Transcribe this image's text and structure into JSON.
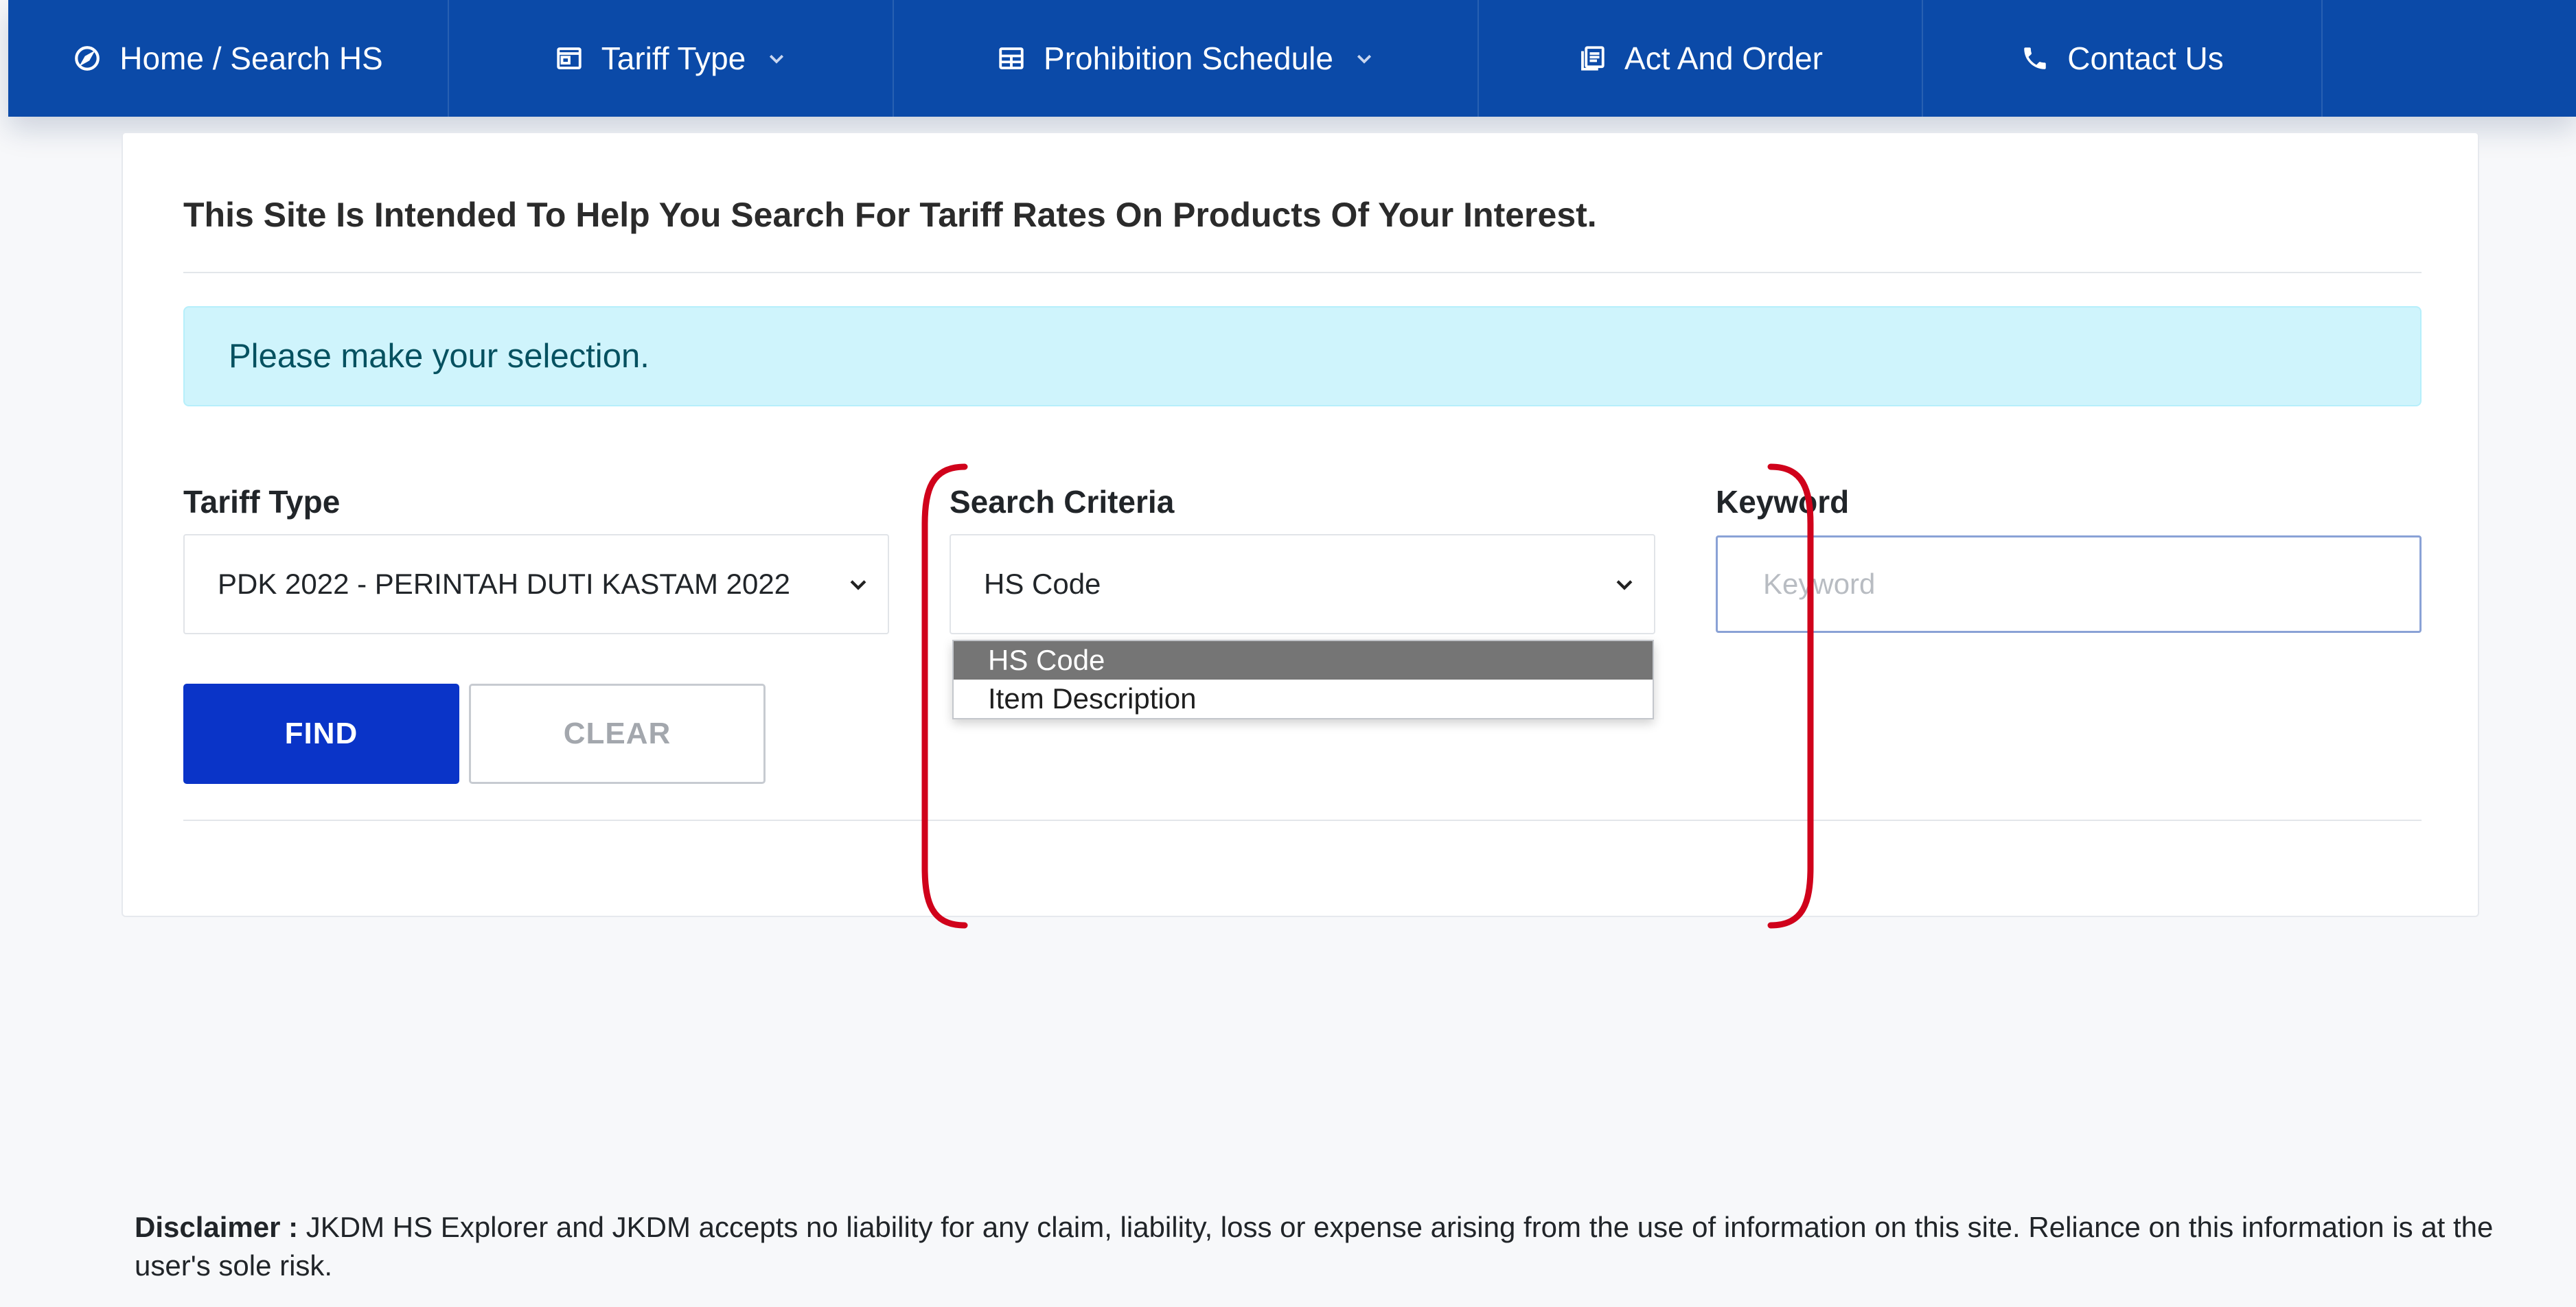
{
  "nav": {
    "home": "Home / Search HS",
    "tariff_type": "Tariff Type",
    "prohibition_schedule": "Prohibition Schedule",
    "act_and_order": "Act And Order",
    "contact_us": "Contact Us"
  },
  "intro_text": "This Site Is Intended To Help You Search For Tariff Rates On Products Of Your Interest.",
  "alert_text": "Please make your selection.",
  "form": {
    "tariff_type_label": "Tariff Type",
    "tariff_type_value": "PDK 2022 - PERINTAH DUTI KASTAM 2022",
    "search_criteria_label": "Search Criteria",
    "search_criteria_value": "HS Code",
    "search_criteria_options": [
      "HS Code",
      "Item Description"
    ],
    "keyword_label": "Keyword",
    "keyword_placeholder": "Keyword",
    "keyword_value": "",
    "find_label": "FIND",
    "clear_label": "CLEAR"
  },
  "disclaimer": {
    "label": "Disclaimer :",
    "text": "JKDM HS Explorer and JKDM accepts no liability for any claim, liability, loss or expense arising from the use of information on this site. Reliance on this information is at the user's sole risk."
  },
  "colors": {
    "nav_bg": "#0b4aa8",
    "find_bg": "#0a34c8",
    "alert_bg": "#cff4fc",
    "alert_text": "#055160",
    "highlight": "#d0021b",
    "option_selected_bg": "#757575"
  }
}
